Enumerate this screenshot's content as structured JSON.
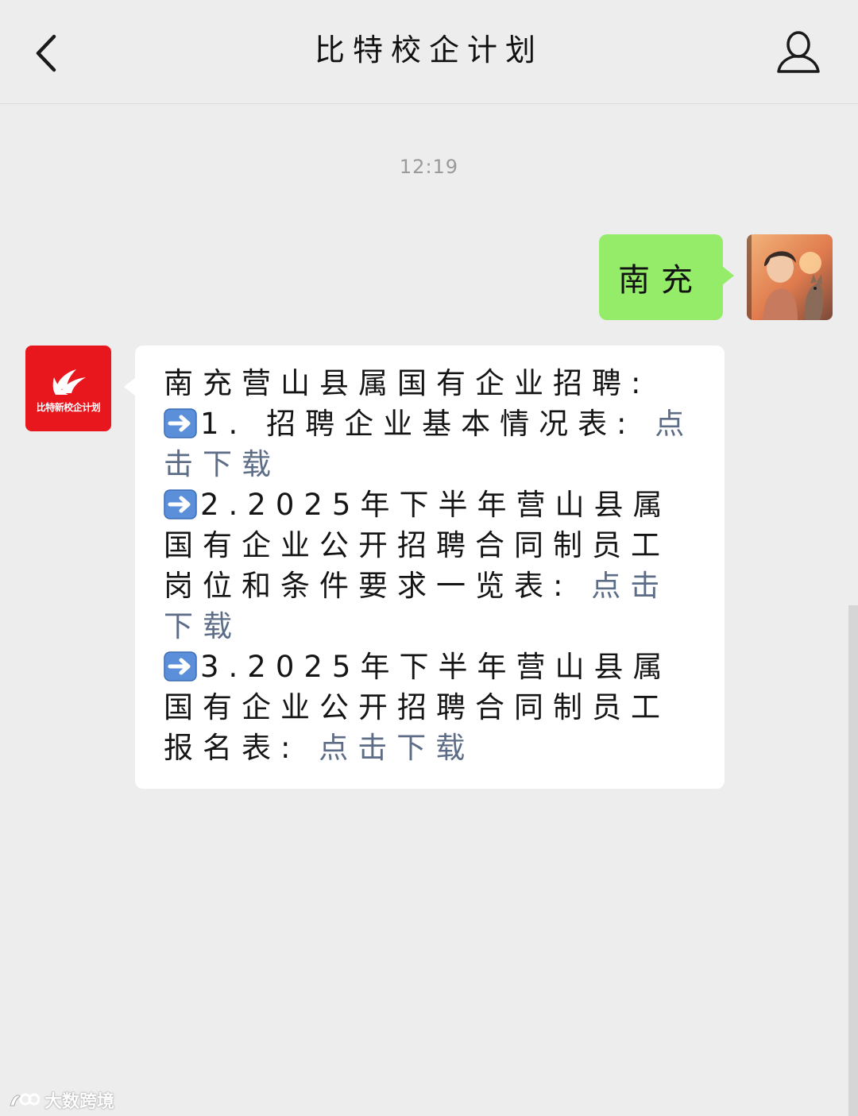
{
  "header": {
    "title": "比特校企计划",
    "back_icon": "chevron-left-icon",
    "profile_icon": "person-icon"
  },
  "chat": {
    "timestamp": "12:19",
    "outgoing": {
      "text": "南充"
    },
    "incoming": {
      "sender_logo_text": "比特新校企计划",
      "intro": "南充营山县属国有企业招聘:",
      "items": [
        {
          "arrow": "➡️",
          "text": "1. 招聘企业基本情况表: ",
          "link": "点击下载"
        },
        {
          "arrow": "➡️",
          "text": "2.2025年下半年营山县属国有企业公开招聘合同制员工岗位和条件要求一览表: ",
          "link": "点击下载"
        },
        {
          "arrow": "➡️",
          "text": "3.2025年下半年营山县属国有企业公开招聘合同制员工报名表: ",
          "link": "点击下载"
        }
      ]
    }
  },
  "watermark": {
    "text": "大数跨境"
  },
  "colors": {
    "background": "#ededed",
    "outgoing_bubble": "#95ec69",
    "incoming_bubble": "#ffffff",
    "link": "#5d6d87",
    "brand_red": "#e8161d"
  }
}
